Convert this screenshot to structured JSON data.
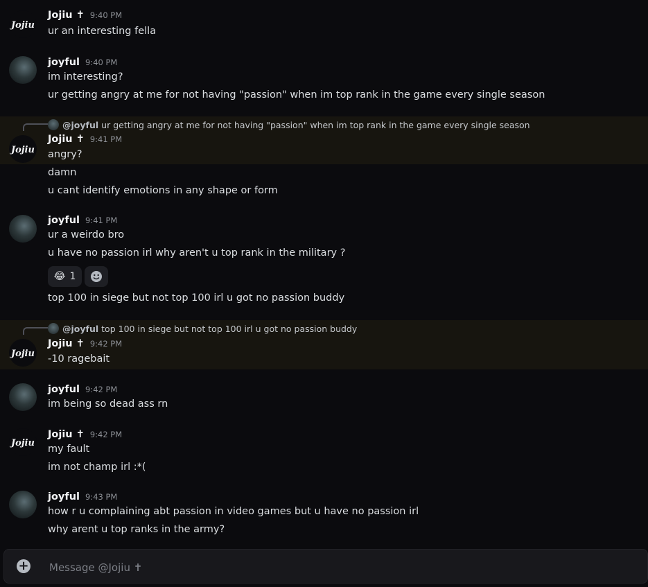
{
  "dm_recipient": "Jojiu ✝",
  "users": {
    "jojiu": "Jojiu ✝",
    "joyful": "joyful"
  },
  "avatar_text": {
    "jojiu": "Jojiu"
  },
  "groups": [
    {
      "author": "Jojiu ✝",
      "time": "9:40 PM",
      "lines": [
        "ur an interesting fella"
      ]
    },
    {
      "author": "joyful",
      "time": "9:40 PM",
      "lines": [
        "im interesting?",
        "ur getting angry at me for not having \"passion\" when im top rank in the game every single season"
      ]
    },
    {
      "reply_to": {
        "mention": "@joyful",
        "text": "ur getting angry at me for not having \"passion\" when im top rank in the game every single season"
      },
      "author": "Jojiu ✝",
      "time": "9:41 PM",
      "lines": [
        "angry?",
        "damn",
        "u cant identify emotions in any shape or form"
      ]
    },
    {
      "author": "joyful",
      "time": "9:41 PM",
      "lines": [
        "ur a weirdo bro",
        "u have no passion irl why aren't u top rank in the military ?",
        "top 100 in siege but not top 100 irl u got no passion buddy"
      ],
      "reactions": [
        {
          "emoji": "😂",
          "count": "1"
        }
      ]
    },
    {
      "reply_to": {
        "mention": "@joyful",
        "text": "top 100 in siege but not top 100 irl u got no passion buddy"
      },
      "author": "Jojiu ✝",
      "time": "9:42 PM",
      "lines": [
        "-10 ragebait"
      ]
    },
    {
      "author": "joyful",
      "time": "9:42 PM",
      "lines": [
        "im being so dead ass rn"
      ]
    },
    {
      "author": "Jojiu ✝",
      "time": "9:42 PM",
      "lines": [
        "my fault",
        "im not champ irl :*("
      ]
    },
    {
      "author": "joyful",
      "time": "9:43 PM",
      "lines": [
        "how r u complaining abt passion in video games but u have no passion irl",
        "why arent u top ranks in the army?"
      ]
    }
  ],
  "composer": {
    "placeholder": "Message @Jojiu ✝",
    "value": ""
  }
}
